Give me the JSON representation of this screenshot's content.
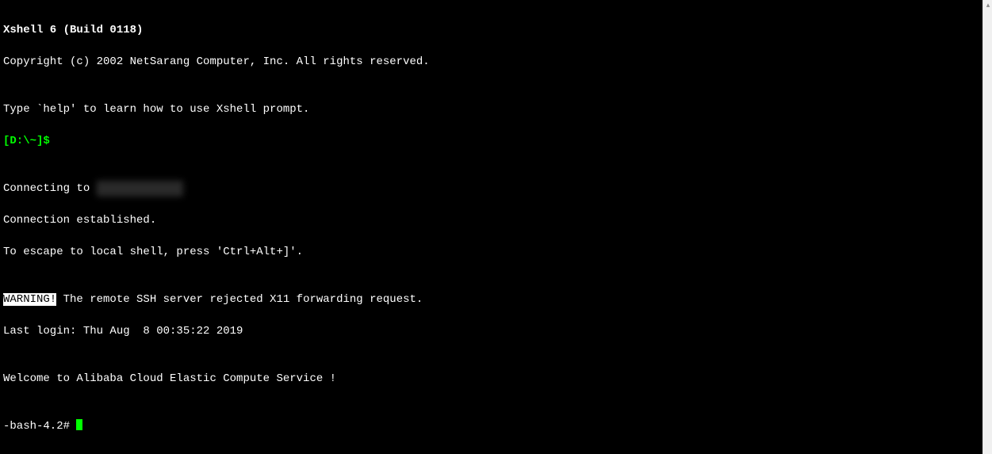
{
  "terminal": {
    "title": "Xshell 6 (Build 0118)",
    "copyright": "Copyright (c) 2002 NetSarang Computer, Inc. All rights reserved.",
    "blank1": "",
    "help_hint": "Type `help' to learn how to use Xshell prompt.",
    "local_prompt": "[D:\\~]$",
    "blank2": "",
    "connecting_prefix": "Connecting to ",
    "connecting_redacted": "███.██.████..",
    "connection_established": "Connection established.",
    "escape_hint": "To escape to local shell, press 'Ctrl+Alt+]'.",
    "blank3": "",
    "warning_label": "WARNING!",
    "warning_msg": " The remote SSH server rejected X11 forwarding request.",
    "last_login": "Last login: Thu Aug  8 00:35:22 2019",
    "blank4": "",
    "welcome": "Welcome to Alibaba Cloud Elastic Compute Service !",
    "blank5": "",
    "remote_prompt": "-bash-4.2# "
  }
}
